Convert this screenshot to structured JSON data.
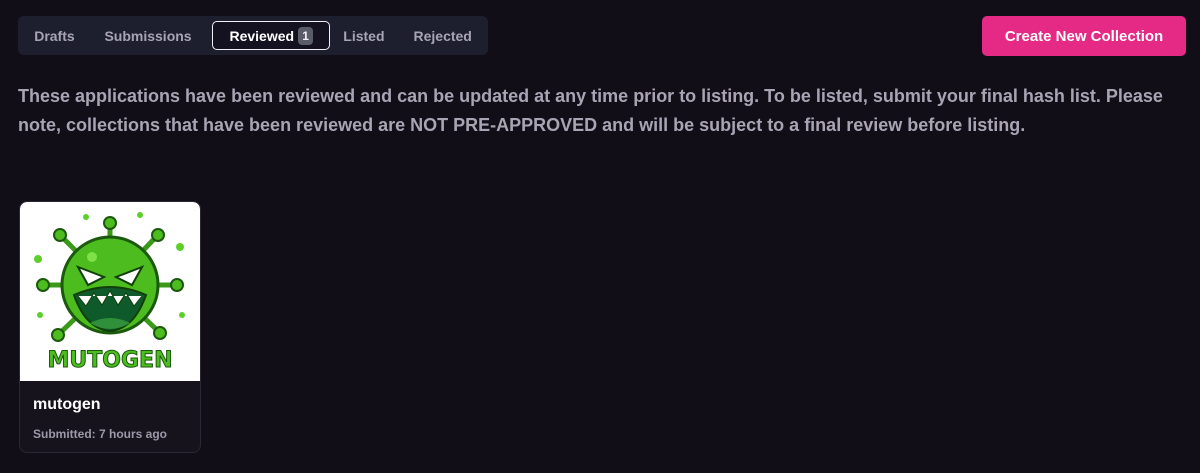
{
  "tabs": [
    {
      "label": "Drafts"
    },
    {
      "label": "Submissions"
    },
    {
      "label": "Reviewed",
      "badge": "1",
      "active": true
    },
    {
      "label": "Listed"
    },
    {
      "label": "Rejected"
    }
  ],
  "create_button": {
    "label": "Create New Collection"
  },
  "description": "These applications have been reviewed and can be updated at any time prior to listing. To be listed, submit your final hash list. Please note, collections that have been reviewed are NOT PRE-APPROVED and will be subject to a final review before listing.",
  "collections": [
    {
      "name": "mutogen",
      "submitted": "Submitted: 7 hours ago",
      "image_text": "MUTOGEN",
      "image_icon": "virus-mascot-logo"
    }
  ],
  "colors": {
    "background": "#120e17",
    "accent": "#e52a86",
    "tab_bar": "#1e1f2e",
    "virus_green": "#4cbc1f"
  }
}
